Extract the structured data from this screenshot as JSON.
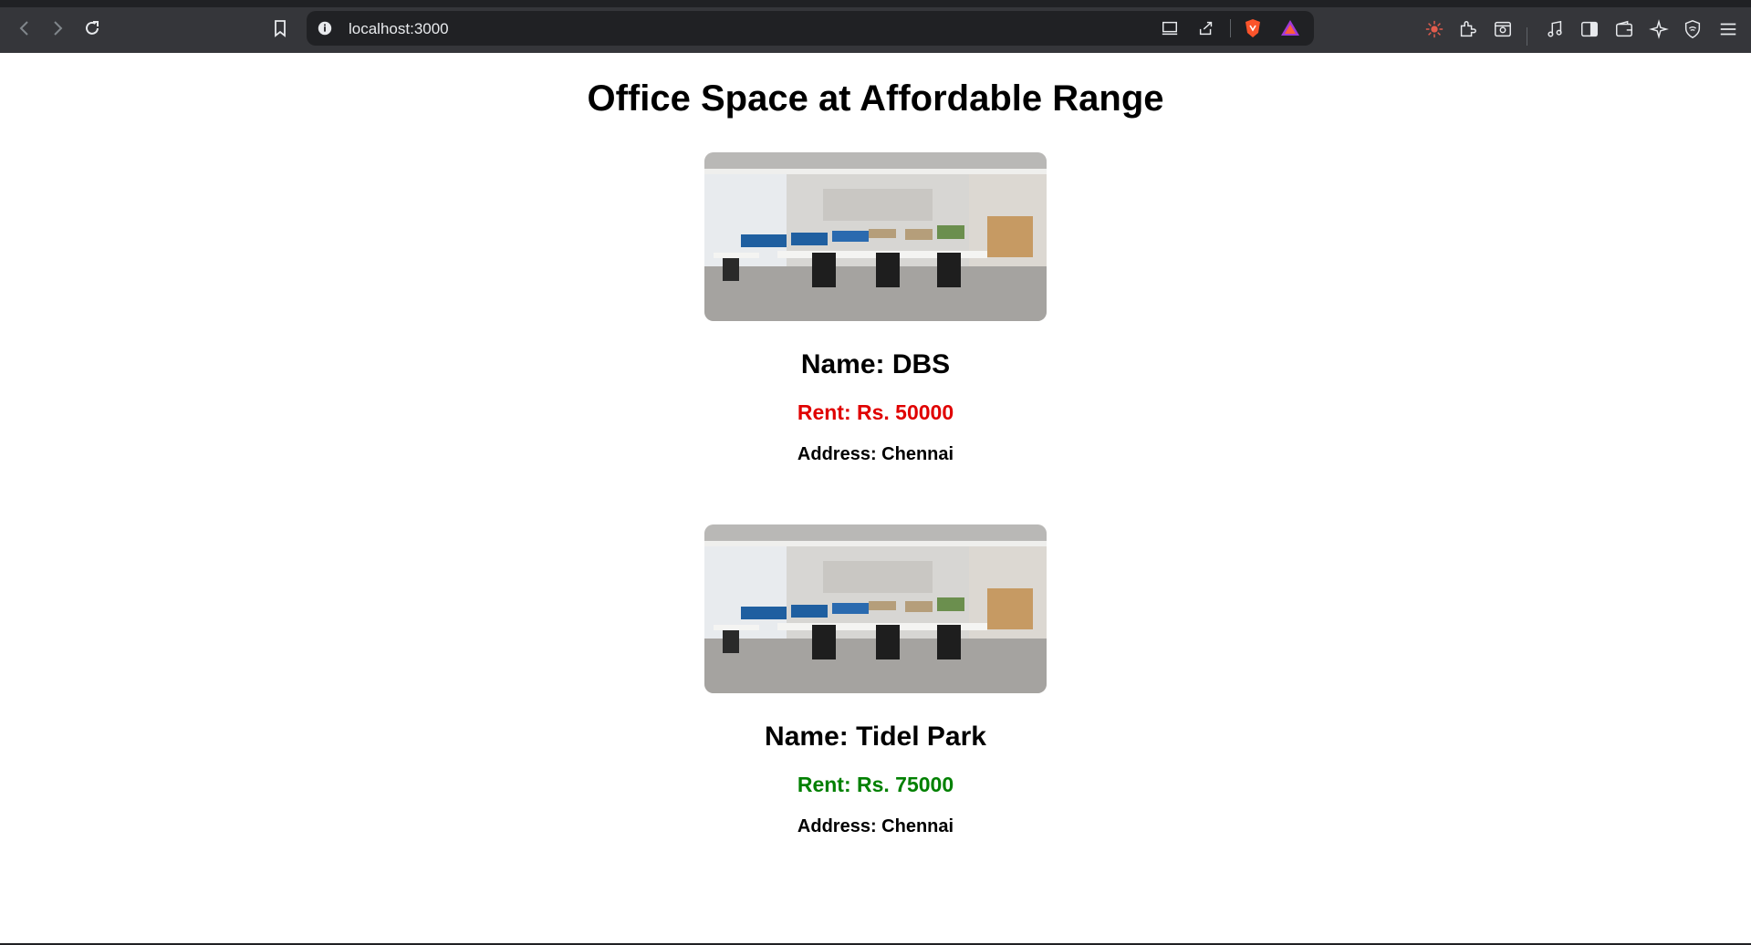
{
  "browser": {
    "url": "localhost:3000",
    "icons": [
      "back-icon",
      "forward-icon",
      "reload-icon",
      "bookmark-icon",
      "site-info-icon",
      "cast-icon",
      "share-icon",
      "brave-shields-icon",
      "brave-rewards-icon",
      "leo-icon",
      "extensions-icon",
      "screenshot-icon",
      "media-icon",
      "sidebar-icon",
      "wallet-icon",
      "ai-icon",
      "vpn-icon",
      "menu-icon"
    ]
  },
  "page": {
    "title": "Office Space at Affordable Range",
    "offices": [
      {
        "name": "Name: DBS",
        "rent": "Rent: Rs. 50000",
        "rent_color": "#e00000",
        "address": "Address: Chennai"
      },
      {
        "name": "Name: Tidel Park",
        "rent": "Rent: Rs. 75000",
        "rent_color": "#008000",
        "address": "Address: Chennai"
      }
    ]
  }
}
